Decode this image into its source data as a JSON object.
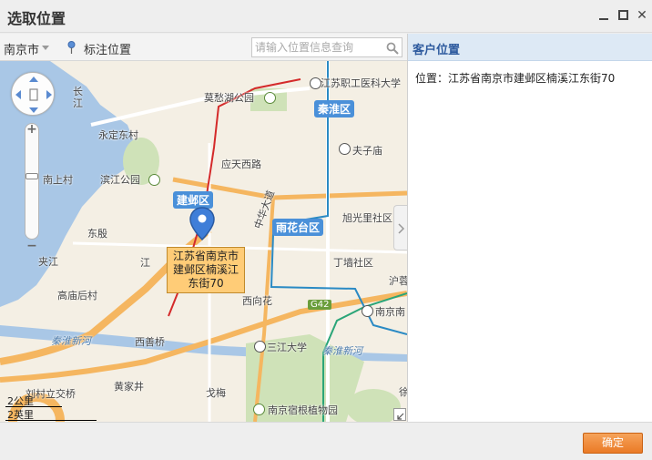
{
  "dialog": {
    "title": "选取位置"
  },
  "toolbar": {
    "city": "南京市",
    "mark_location": "标注位置",
    "search_placeholder": "请输入位置信息查询"
  },
  "map": {
    "labels": {
      "mochou_park": "莫愁湖公园",
      "jiangsu_poly": "江苏职工医科大学",
      "qinhuai": "秦淮区",
      "fuzimiao": "夫子庙",
      "yongding": "永定东村",
      "binjiang_park": "滨江公园",
      "yingtian_road": "应天西路",
      "jianye": "建邺区",
      "nanshang": "南上村",
      "dongyin": "东殷",
      "yuhuatai": "雨花台区",
      "xuguangli": "旭光里社区",
      "jiang": "江",
      "yangtze1": "长",
      "yangtze2": "江",
      "jiaqiang": "夹江",
      "gaomiao": "高庙后村",
      "dingwang": "丁墙社区",
      "xixiang": "西向花",
      "g42": "G42",
      "nanjing_south": "南京南",
      "qinhuai_new": "秦淮新河",
      "xishan": "西善桥",
      "sanjiang": "三江大学",
      "qinhuai_new2": "秦淮新河",
      "huangjiajing": "黄家井",
      "liucun": "刘村立交桥",
      "gemei": "戈梅",
      "botanical": "南京宿根植物园",
      "zhonghua": "中华大道",
      "yulu": "沪蓉",
      "xun": "徐"
    },
    "infobox": "江苏省南京市建邺区楠溪江东街70",
    "scale_km": "2公里",
    "scale_mi": "2英里"
  },
  "right_panel": {
    "title": "客户位置",
    "address": "位置：江苏省南京市建邺区楠溪江东街70"
  },
  "footer": {
    "ok_label": "确定"
  }
}
